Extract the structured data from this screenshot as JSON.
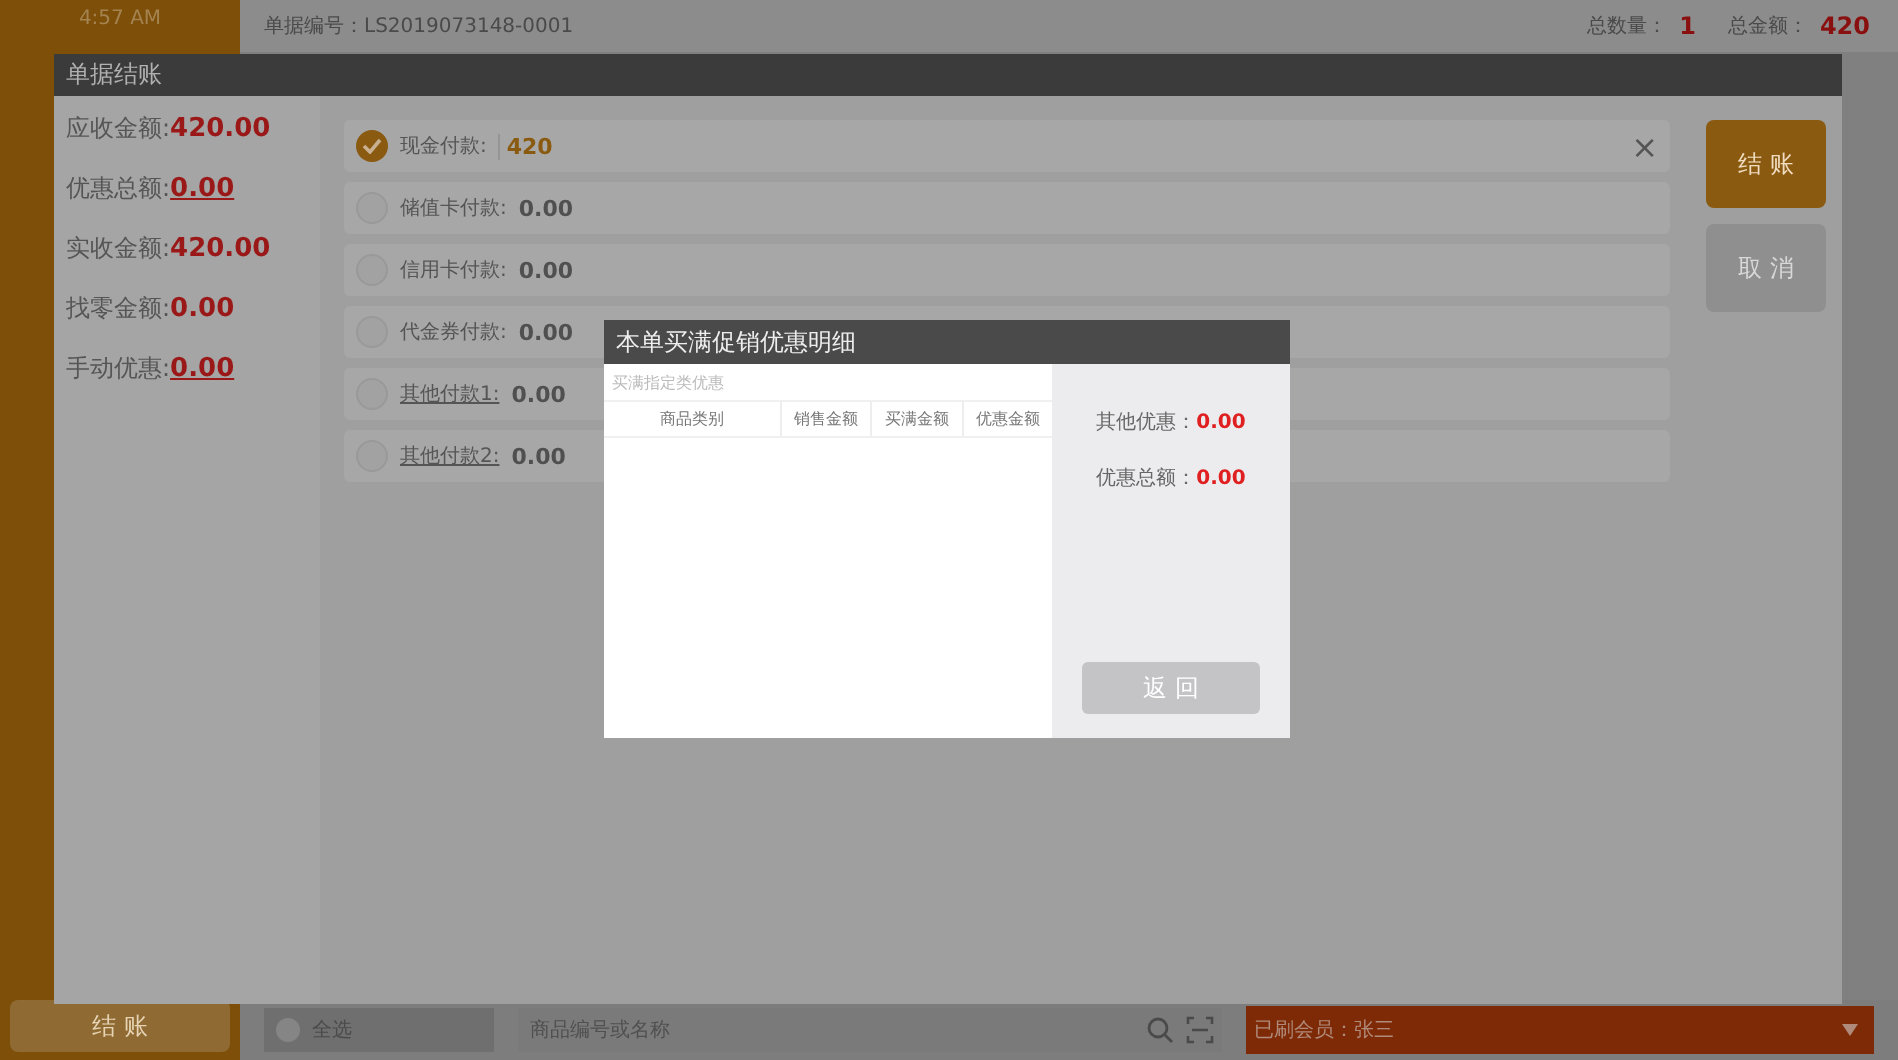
{
  "sidebar": {
    "time": "4:57 AM",
    "checkout_button": "结 账"
  },
  "header": {
    "order_no": "单据编号：LS2019073148-0001",
    "qty_label": "总数量：",
    "qty": "1",
    "total_label": "总金额：",
    "total": "420"
  },
  "bottom_bar": {
    "select_all": {
      "label": "全选",
      "checked": false
    },
    "search": {
      "placeholder": "商品编号或名称"
    },
    "member": "已刷会员：张三"
  },
  "checkout_dialog": {
    "title": "单据结账",
    "summary": [
      {
        "label": "应收金额:",
        "value": "420.00",
        "underline": false
      },
      {
        "label": "优惠总额:",
        "value": "0.00",
        "underline": true
      },
      {
        "label": "实收金额:",
        "value": "420.00",
        "underline": false
      },
      {
        "label": "找零金额:",
        "value": "0.00",
        "underline": false
      },
      {
        "label": "手动优惠:",
        "value": "0.00",
        "underline": true
      }
    ],
    "payments": [
      {
        "label": "现金付款:",
        "value": "420",
        "selected": true,
        "link": false
      },
      {
        "label": "储值卡付款:",
        "value": "0.00",
        "selected": false,
        "link": false
      },
      {
        "label": "信用卡付款:",
        "value": "0.00",
        "selected": false,
        "link": false
      },
      {
        "label": "代金券付款:",
        "value": "0.00",
        "selected": false,
        "link": false
      },
      {
        "label": "其他付款1:",
        "value": "0.00",
        "selected": false,
        "link": true
      },
      {
        "label": "其他付款2:",
        "value": "0.00",
        "selected": false,
        "link": true
      }
    ],
    "close_icon": "×",
    "buttons": [
      {
        "label": "结 账",
        "disabled": false
      },
      {
        "label": "取 消",
        "disabled": true
      }
    ]
  },
  "promo_dialog": {
    "title": "本单买满促销优惠明细",
    "section": "买满指定类优惠",
    "columns": [
      "商品类别",
      "销售金额",
      "买满金额",
      "优惠金额"
    ],
    "other_label": "其他优惠：",
    "other_value": "0.00",
    "total_label": "优惠总额：",
    "total_value": "0.00",
    "back_button": "返 回"
  }
}
